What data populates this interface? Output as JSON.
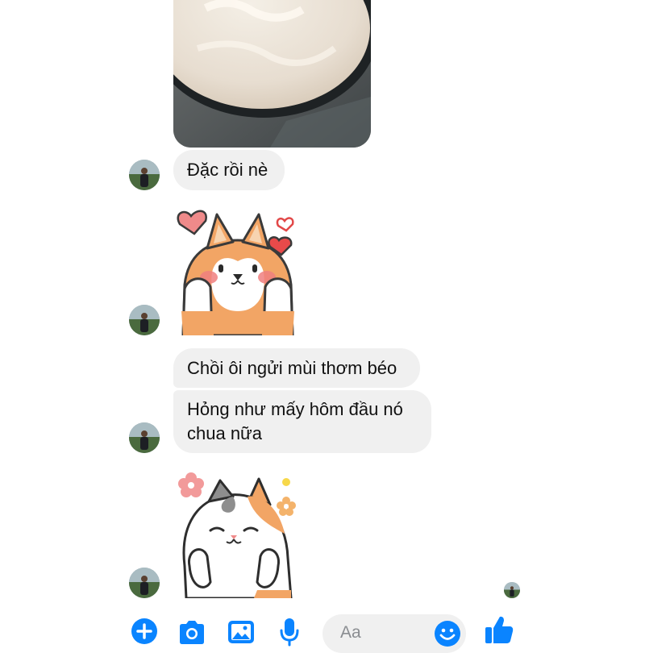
{
  "messages": [
    {
      "type": "image",
      "description_name": "yogurt-bowl-photo"
    },
    {
      "type": "text",
      "text": "Đặc rồi nè"
    },
    {
      "type": "sticker",
      "name": "shiba-dog-hearts-sticker"
    },
    {
      "type": "text",
      "text": "Chồi ôi ngửi mùi thơm béo"
    },
    {
      "type": "text",
      "text": "Hỏng như mấy hôm đầu nó chua nữa"
    },
    {
      "type": "sticker",
      "name": "calico-cat-flowers-sticker"
    }
  ],
  "composer": {
    "placeholder": "Aa",
    "icons": [
      "plus-icon",
      "camera-icon",
      "image-icon",
      "microphone-icon",
      "emoji-icon",
      "thumbs-up-icon"
    ]
  },
  "colors": {
    "accent": "#0a84ff",
    "bubble": "#f0f0f0",
    "text": "#111111"
  }
}
